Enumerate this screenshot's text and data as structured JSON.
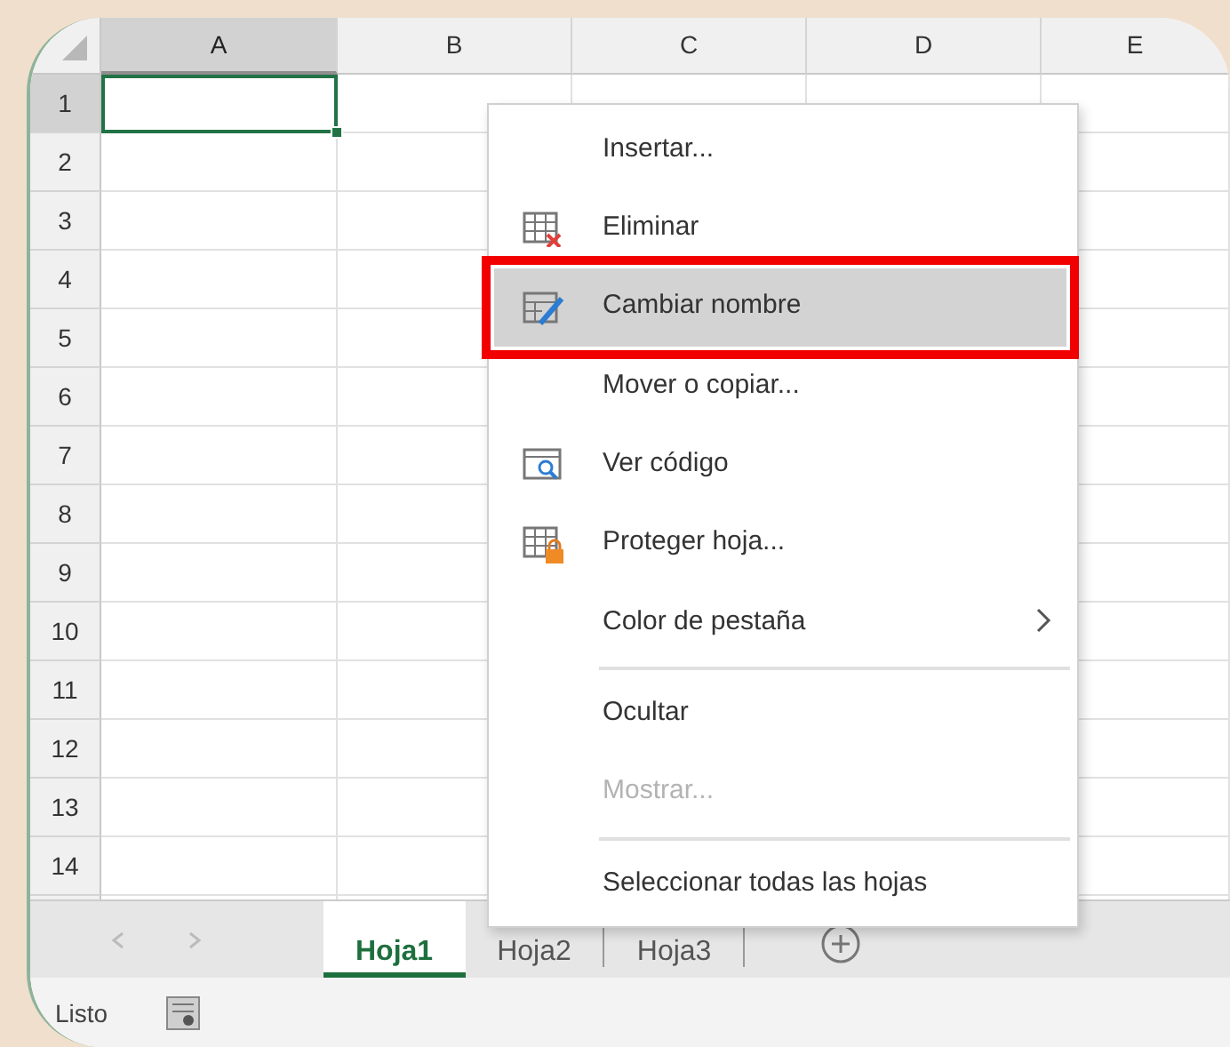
{
  "columns": [
    {
      "label": "A",
      "selected": true
    },
    {
      "label": "B",
      "selected": false
    },
    {
      "label": "C",
      "selected": false
    },
    {
      "label": "D",
      "selected": false
    },
    {
      "label": "E",
      "selected": false
    }
  ],
  "rows": [
    {
      "label": "1",
      "selected": true
    },
    {
      "label": "2",
      "selected": false
    },
    {
      "label": "3",
      "selected": false
    },
    {
      "label": "4",
      "selected": false
    },
    {
      "label": "5",
      "selected": false
    },
    {
      "label": "6",
      "selected": false
    },
    {
      "label": "7",
      "selected": false
    },
    {
      "label": "8",
      "selected": false
    },
    {
      "label": "9",
      "selected": false
    },
    {
      "label": "10",
      "selected": false
    },
    {
      "label": "11",
      "selected": false
    },
    {
      "label": "12",
      "selected": false
    },
    {
      "label": "13",
      "selected": false
    },
    {
      "label": "14",
      "selected": false
    }
  ],
  "context_menu": {
    "items": [
      {
        "label": "Insertar...",
        "kind": "plain",
        "selected": false,
        "disabled": false,
        "submenu": false,
        "separator_before": false,
        "outlined": false
      },
      {
        "label": "Eliminar",
        "kind": "delete",
        "selected": false,
        "disabled": false,
        "submenu": false,
        "separator_before": false,
        "outlined": false
      },
      {
        "label": "Cambiar nombre",
        "kind": "rename",
        "selected": true,
        "disabled": false,
        "submenu": false,
        "separator_before": false,
        "outlined": true
      },
      {
        "label": "Mover o copiar...",
        "kind": "plain",
        "selected": false,
        "disabled": false,
        "submenu": false,
        "separator_before": false,
        "outlined": false
      },
      {
        "label": "Ver código",
        "kind": "code",
        "selected": false,
        "disabled": false,
        "submenu": false,
        "separator_before": false,
        "outlined": false
      },
      {
        "label": "Proteger hoja...",
        "kind": "protect",
        "selected": false,
        "disabled": false,
        "submenu": false,
        "separator_before": false,
        "outlined": false
      },
      {
        "label": "Color de pestaña",
        "kind": "plain",
        "selected": false,
        "disabled": false,
        "submenu": true,
        "separator_before": false,
        "outlined": false
      },
      {
        "label": "Ocultar",
        "kind": "plain",
        "selected": false,
        "disabled": false,
        "submenu": false,
        "separator_before": true,
        "outlined": false
      },
      {
        "label": "Mostrar...",
        "kind": "plain",
        "selected": false,
        "disabled": true,
        "submenu": false,
        "separator_before": false,
        "outlined": false
      },
      {
        "label": "Seleccionar todas las hojas",
        "kind": "plain",
        "selected": false,
        "disabled": false,
        "submenu": false,
        "separator_before": true,
        "outlined": false
      }
    ]
  },
  "sheet_tabs": [
    {
      "label": "Hoja1",
      "selected": true
    },
    {
      "label": "Hoja2",
      "selected": false
    },
    {
      "label": "Hoja3",
      "selected": false
    }
  ],
  "status_bar": {
    "text": "Listo"
  }
}
